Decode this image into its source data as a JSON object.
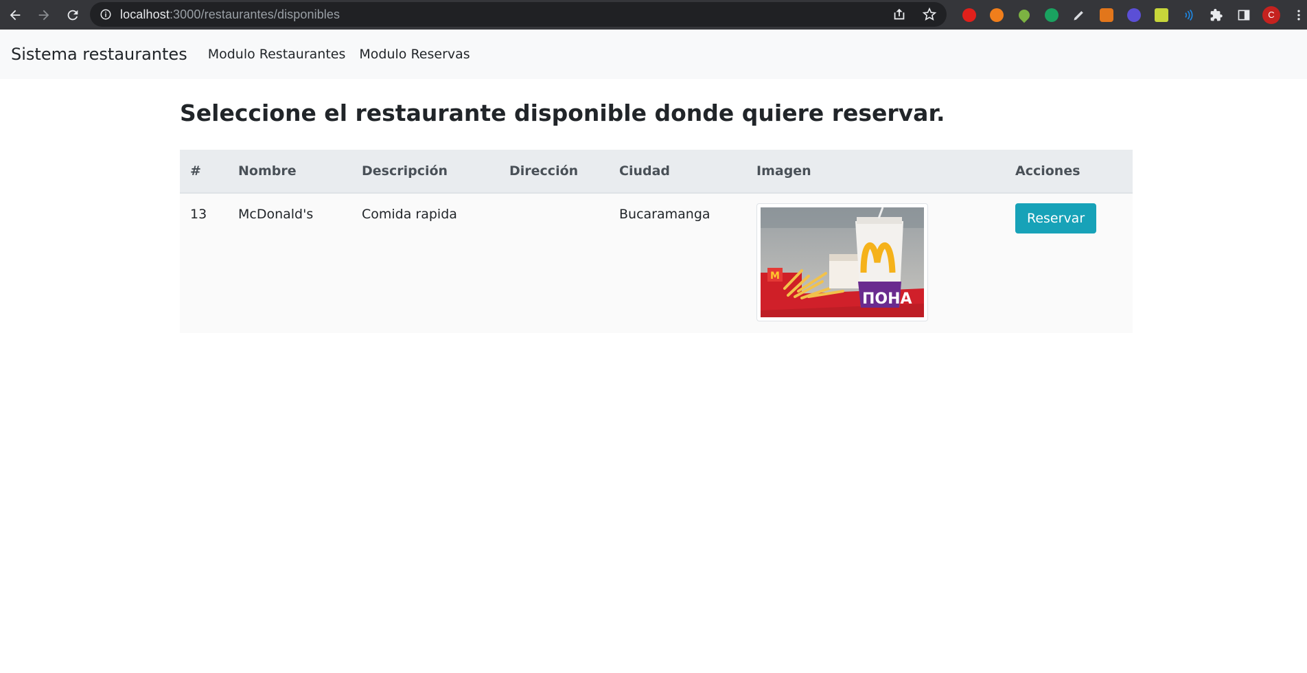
{
  "browser": {
    "url_host": "localhost",
    "url_path": ":3000/restaurantes/disponibles",
    "profile_initial": "C"
  },
  "navbar": {
    "brand": "Sistema restaurantes",
    "links": [
      "Modulo Restaurantes",
      "Modulo Reservas"
    ]
  },
  "main": {
    "title": "Seleccione el restaurante disponible donde quiere reservar.",
    "table": {
      "headers": [
        "#",
        "Nombre",
        "Descripción",
        "Dirección",
        "Ciudad",
        "Imagen",
        "Acciones"
      ],
      "rows": [
        {
          "id": "13",
          "nombre": "McDonald's",
          "descripcion": "Comida rapida",
          "direccion": "",
          "ciudad": "Bucaramanga",
          "accion": "Reservar"
        }
      ]
    }
  },
  "colors": {
    "chrome_bg": "#35363a",
    "omnibox_bg": "#202124",
    "navbar_bg": "#f8f9fa",
    "table_header_bg": "#e9ecef",
    "button_info": "#17a2b8"
  },
  "icons": [
    "back-icon",
    "forward-icon",
    "reload-icon",
    "info-icon",
    "share-icon",
    "star-icon",
    "puzzle-icon",
    "side-panel-icon",
    "more-icon"
  ]
}
